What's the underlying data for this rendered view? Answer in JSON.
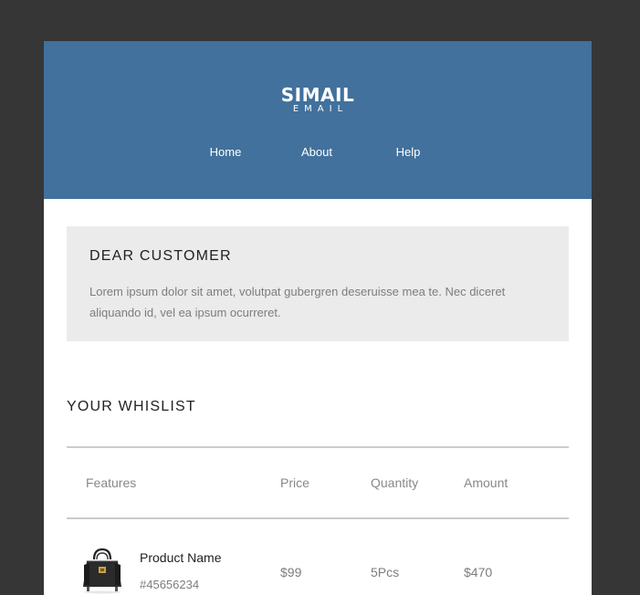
{
  "logo": {
    "main": "SIMAIL",
    "sub": "EMAIL"
  },
  "nav": {
    "items": [
      "Home",
      "About",
      "Help"
    ]
  },
  "greeting": {
    "title": "DEAR CUSTOMER",
    "body": "Lorem ipsum dolor sit amet, volutpat gubergren deseruisse mea te. Nec diceret aliquando id, vel ea ipsum ocurreret."
  },
  "wishlist": {
    "title": "YOUR WHISLIST",
    "columns": [
      "Features",
      "Price",
      "Quantity",
      "Amount"
    ],
    "rows": [
      {
        "image_icon": "handbag-icon",
        "name": "Product Name",
        "sku": "#45656234",
        "price": "$99",
        "quantity": "5Pcs",
        "amount": "$470"
      }
    ]
  },
  "colors": {
    "backdrop": "#363636",
    "header": "#41719c",
    "greeting_box": "#ebebeb",
    "rule": "#cccccc"
  }
}
